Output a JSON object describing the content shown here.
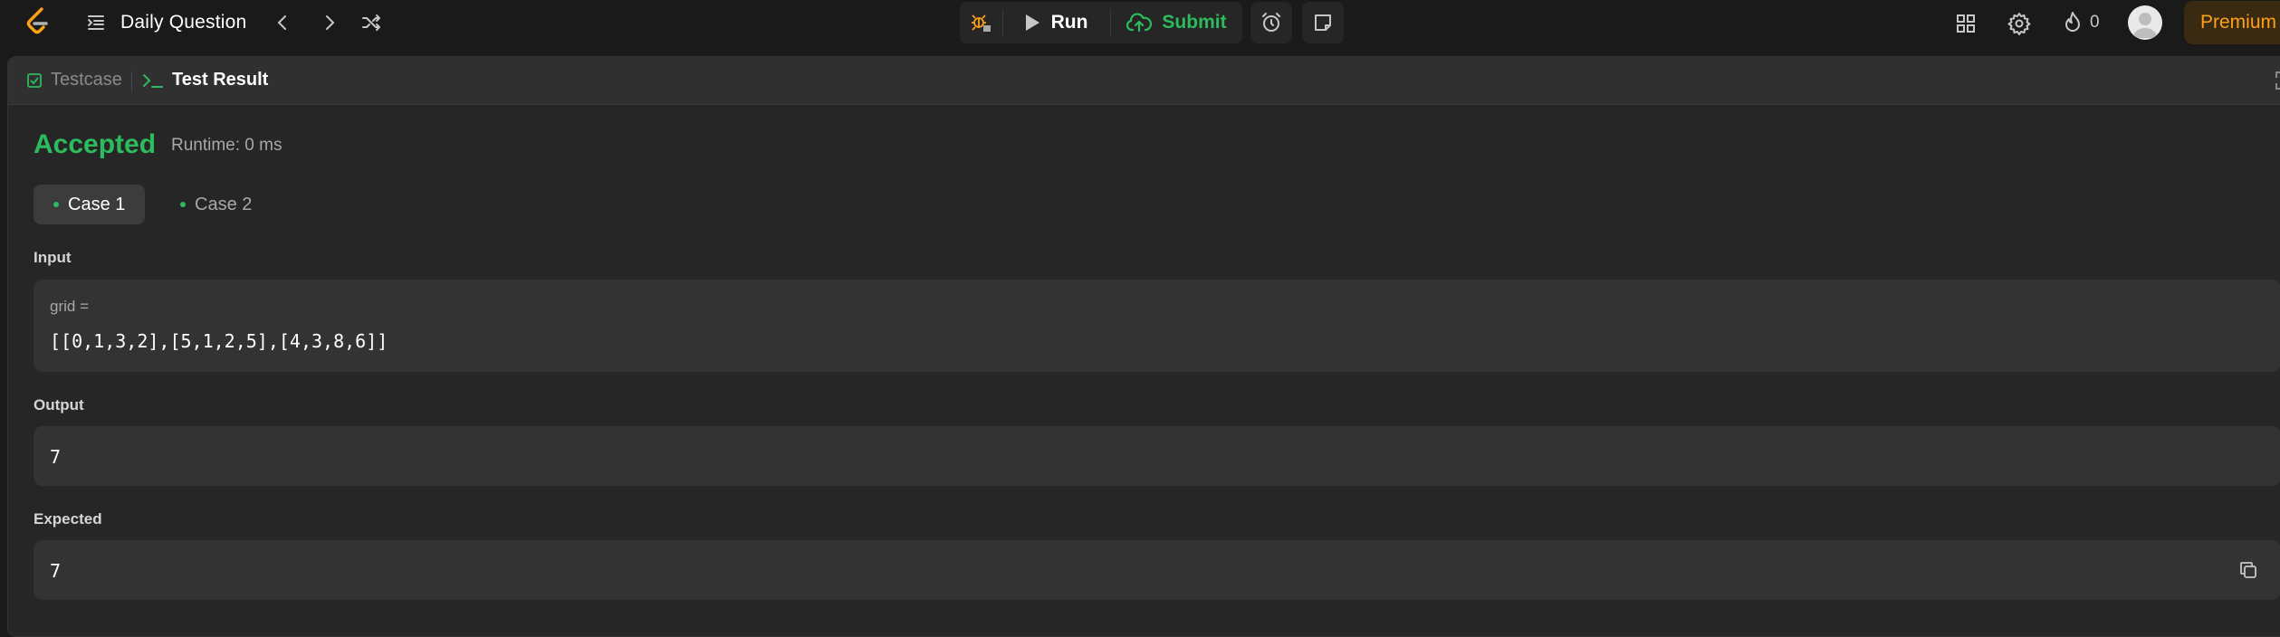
{
  "nav": {
    "title": "Daily Question",
    "run_label": "Run",
    "submit_label": "Submit",
    "streak_count": "0",
    "premium_label": "Premium"
  },
  "panel": {
    "tabs": [
      {
        "label": "Testcase"
      },
      {
        "label": "Test Result"
      }
    ],
    "status": "Accepted",
    "runtime": "Runtime: 0 ms",
    "cases": [
      {
        "label": "Case 1"
      },
      {
        "label": "Case 2"
      }
    ],
    "input_label": "Input",
    "input_var": "grid =",
    "input_value": "[[0,1,3,2],[5,1,2,5],[4,3,8,6]]",
    "output_label": "Output",
    "output_value": "7",
    "expected_label": "Expected",
    "expected_value": "7"
  },
  "colors": {
    "accent_green": "#2cbb5d",
    "premium_orange": "#ffa116",
    "background": "#1a1a1a",
    "panel": "#262626"
  }
}
